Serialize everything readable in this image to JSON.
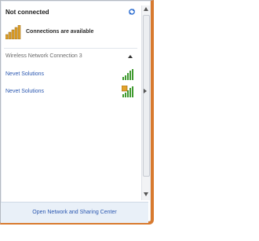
{
  "panel": {
    "status": "Not connected",
    "connections_text": "Connections are available",
    "section_title": "Wireless Network Connection 3",
    "networks": [
      {
        "name": "Nevet Solutions"
      },
      {
        "name": "Nevet Solutions"
      }
    ],
    "footer_link": "Open Network and Sharing Center"
  },
  "colors": {
    "accent_border": "#d87a2f",
    "link": "#2a57b0",
    "signal_green": "#3f9a2f",
    "signal_orange": "#e2a22a",
    "footer_bg": "#e9f0f8"
  },
  "icons": {
    "refresh": "refresh-icon",
    "connections": "signal-bars-icon",
    "collapse": "chevron-up-icon",
    "network_signal": "wifi-signal-icon"
  }
}
